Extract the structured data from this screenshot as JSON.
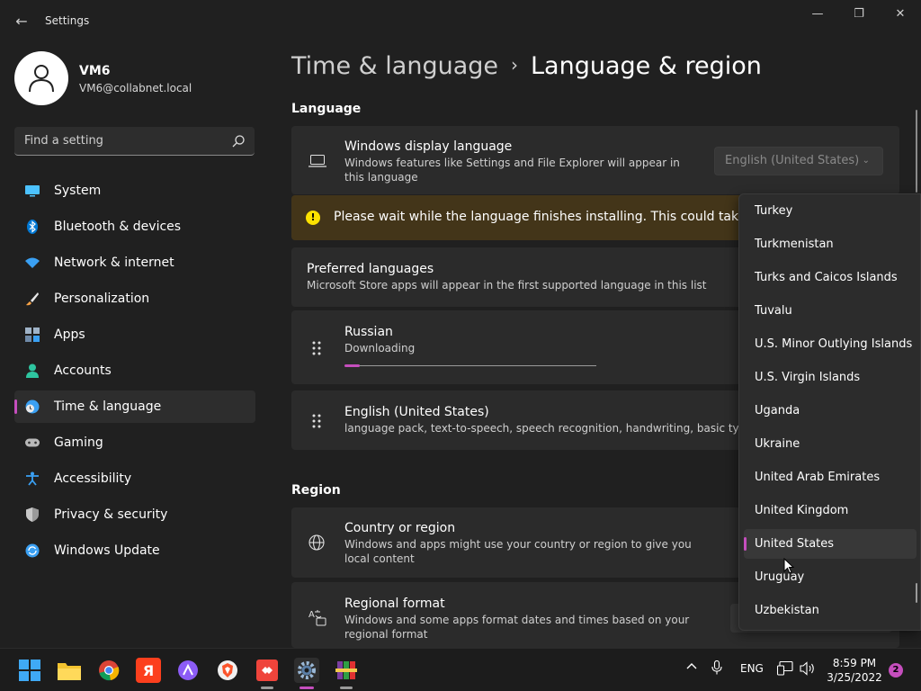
{
  "window": {
    "title": "Settings",
    "minimize_glyph": "—",
    "maximize_glyph": "❐",
    "close_glyph": "✕"
  },
  "profile": {
    "name": "VM6",
    "email": "VM6@collabnet.local"
  },
  "search": {
    "placeholder": "Find a setting",
    "value": ""
  },
  "sidebar": {
    "items": [
      {
        "label": "System",
        "icon": "monitor-icon"
      },
      {
        "label": "Bluetooth & devices",
        "icon": "bluetooth-icon"
      },
      {
        "label": "Network & internet",
        "icon": "wifi-icon"
      },
      {
        "label": "Personalization",
        "icon": "brush-icon"
      },
      {
        "label": "Apps",
        "icon": "apps-icon"
      },
      {
        "label": "Accounts",
        "icon": "person-icon"
      },
      {
        "label": "Time & language",
        "icon": "clock-globe-icon",
        "active": true
      },
      {
        "label": "Gaming",
        "icon": "gamepad-icon"
      },
      {
        "label": "Accessibility",
        "icon": "accessibility-icon"
      },
      {
        "label": "Privacy & security",
        "icon": "shield-icon"
      },
      {
        "label": "Windows Update",
        "icon": "update-icon"
      }
    ]
  },
  "breadcrumb": {
    "parent": "Time & language",
    "separator": "›",
    "current": "Language & region"
  },
  "language": {
    "section_title": "Language",
    "display_language": {
      "title": "Windows display language",
      "description": "Windows features like Settings and File Explorer will appear in this language",
      "selected": "English (United States)"
    },
    "warning": "Please wait while the language finishes installing. This could take a few minutes.",
    "preferred": {
      "title": "Preferred languages",
      "description": "Microsoft Store apps will appear in the first supported language in this list"
    },
    "languages": [
      {
        "name": "Russian",
        "status": "Downloading",
        "progress": 0.06
      },
      {
        "name": "English (United States)",
        "status": "language pack, text-to-speech, speech recognition, handwriting, basic typing"
      }
    ]
  },
  "region": {
    "section_title": "Region",
    "country": {
      "title": "Country or region",
      "description": "Windows and apps might use your country or region to give you local content"
    },
    "format": {
      "title": "Regional format",
      "description": "Windows and some apps format dates and times based on your regional format"
    }
  },
  "country_list": {
    "items": [
      "Turkey",
      "Turkmenistan",
      "Turks and Caicos Islands",
      "Tuvalu",
      "U.S. Minor Outlying Islands",
      "U.S. Virgin Islands",
      "Uganda",
      "Ukraine",
      "United Arab Emirates",
      "United Kingdom",
      "United States",
      "Uruguay",
      "Uzbekistan"
    ],
    "selected": "United States"
  },
  "taskbar": {
    "apps": [
      "start-icon",
      "file-explorer-icon",
      "chrome-icon",
      "yandex-browser-icon",
      "alice-icon",
      "brave-icon",
      "anydesk-icon",
      "settings-icon",
      "winrar-icon"
    ],
    "yandex_glyph": "Я",
    "language": "ENG",
    "time": "8:59 PM",
    "date": "3/25/2022",
    "notifications": "2"
  },
  "colors": {
    "accent": "#c54ebd",
    "warning_bg": "#433519",
    "warning_icon": "#fce100"
  }
}
